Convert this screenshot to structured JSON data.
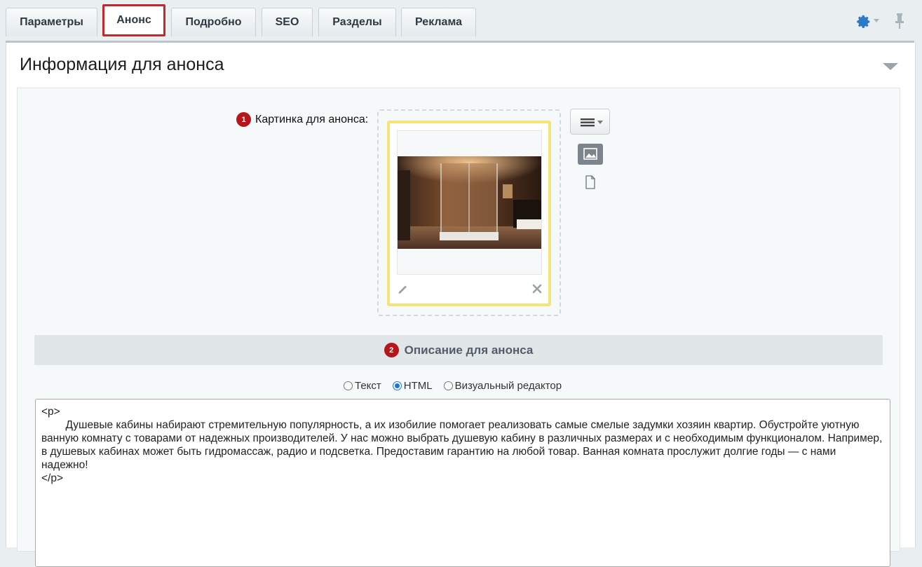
{
  "tabs": [
    {
      "label": "Параметры",
      "active": false
    },
    {
      "label": "Анонс",
      "active": true
    },
    {
      "label": "Подробно",
      "active": false
    },
    {
      "label": "SEO",
      "active": false
    },
    {
      "label": "Разделы",
      "active": false
    },
    {
      "label": "Реклама",
      "active": false
    }
  ],
  "header": {
    "settings_icon": "gear-icon",
    "pin_icon": "pin-icon"
  },
  "panel": {
    "title": "Информация для анонса"
  },
  "preview_image": {
    "label": "Картинка для анонса:",
    "badge": "1",
    "icons": [
      "menu-icon",
      "image-icon",
      "file-icon",
      "pencil-icon",
      "close-icon"
    ]
  },
  "description": {
    "badge": "2",
    "title": "Описание для анонса",
    "format_options": [
      {
        "label": "Текст",
        "checked": false
      },
      {
        "label": "HTML",
        "checked": true
      },
      {
        "label": "Визуальный редактор",
        "checked": false
      }
    ],
    "content": "<p>\n\tДушевые кабины набирают стремительную популярность, а их изобилие помогает реализовать самые смелые задумки хозяин квартир. Обустройте уютную ванную комнату с товарами от надежных производителей. У нас можно выбрать душевую кабину в различных размерах и с необходимым функционалом. Например, в душевых кабинах может быть гидромассаж, радио и подсветка. Предоставим гарантию на любой товар. Ванная комната прослужит долгие годы — с нами надежно!\n</p>"
  },
  "colors": {
    "active_tab_border": "#c0282d",
    "badge": "#b7141c",
    "image_card_border": "#f8e27a",
    "gear": "#2c79c7"
  }
}
